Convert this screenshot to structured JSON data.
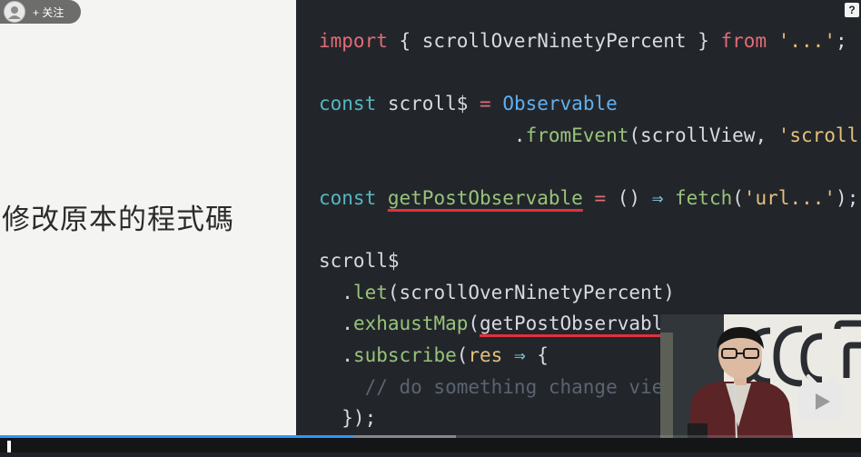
{
  "slide": {
    "title": "修改原本的程式碼",
    "code": {
      "l1": {
        "a": "import",
        "b": " { scrollOverNinetyPercent } ",
        "c": "from",
        "d": " ",
        "e": "'...'",
        "f": ";"
      },
      "l3": {
        "a": "const",
        "b": " scroll$ ",
        "c": "=",
        "d": " ",
        "e": "Observable"
      },
      "l4": {
        "a": "                 .",
        "b": "fromEvent",
        "c": "(scrollView, ",
        "d": "'scroll'",
        "e": ")"
      },
      "l6": {
        "a": "const",
        "b": " ",
        "c": "getPostObservable",
        "d": " ",
        "e": "=",
        "f": " () ",
        "g": "⇒",
        "h": " ",
        "i": "fetch",
        "j": "(",
        "k": "'url...'",
        "l": ");"
      },
      "l8": {
        "a": "scroll$"
      },
      "l9": {
        "a": "  .",
        "b": "let",
        "c": "(scrollOverNinetyPercent)"
      },
      "l10": {
        "a": "  .",
        "b": "exhaustMap",
        "c": "(",
        "d": "getPostObservable",
        "e": ")"
      },
      "l11": {
        "a": "  .",
        "b": "subscribe",
        "c": "(",
        "d": "res",
        "e": " ",
        "f": "⇒",
        "g": " {"
      },
      "l12": {
        "a": "    // do something change view"
      },
      "l13": {
        "a": "  });"
      }
    }
  },
  "overlay": {
    "follow_label": "关注",
    "follow_plus": "+",
    "corner_icon_glyph": "?",
    "avatar_icon": "avatar-icon",
    "play_badge_icon": "bilibili-play-icon"
  },
  "player": {
    "progress_played_pct": 41,
    "progress_buffered_pct": 53
  },
  "colors": {
    "code_bg": "#22262b",
    "slide_bg": "#f4f4f2",
    "keyword": "#e06c75",
    "const": "#56b6c2",
    "function": "#98c379",
    "string": "#e5c07b",
    "underline": "#e0323c",
    "progress": "#2f95ff"
  }
}
